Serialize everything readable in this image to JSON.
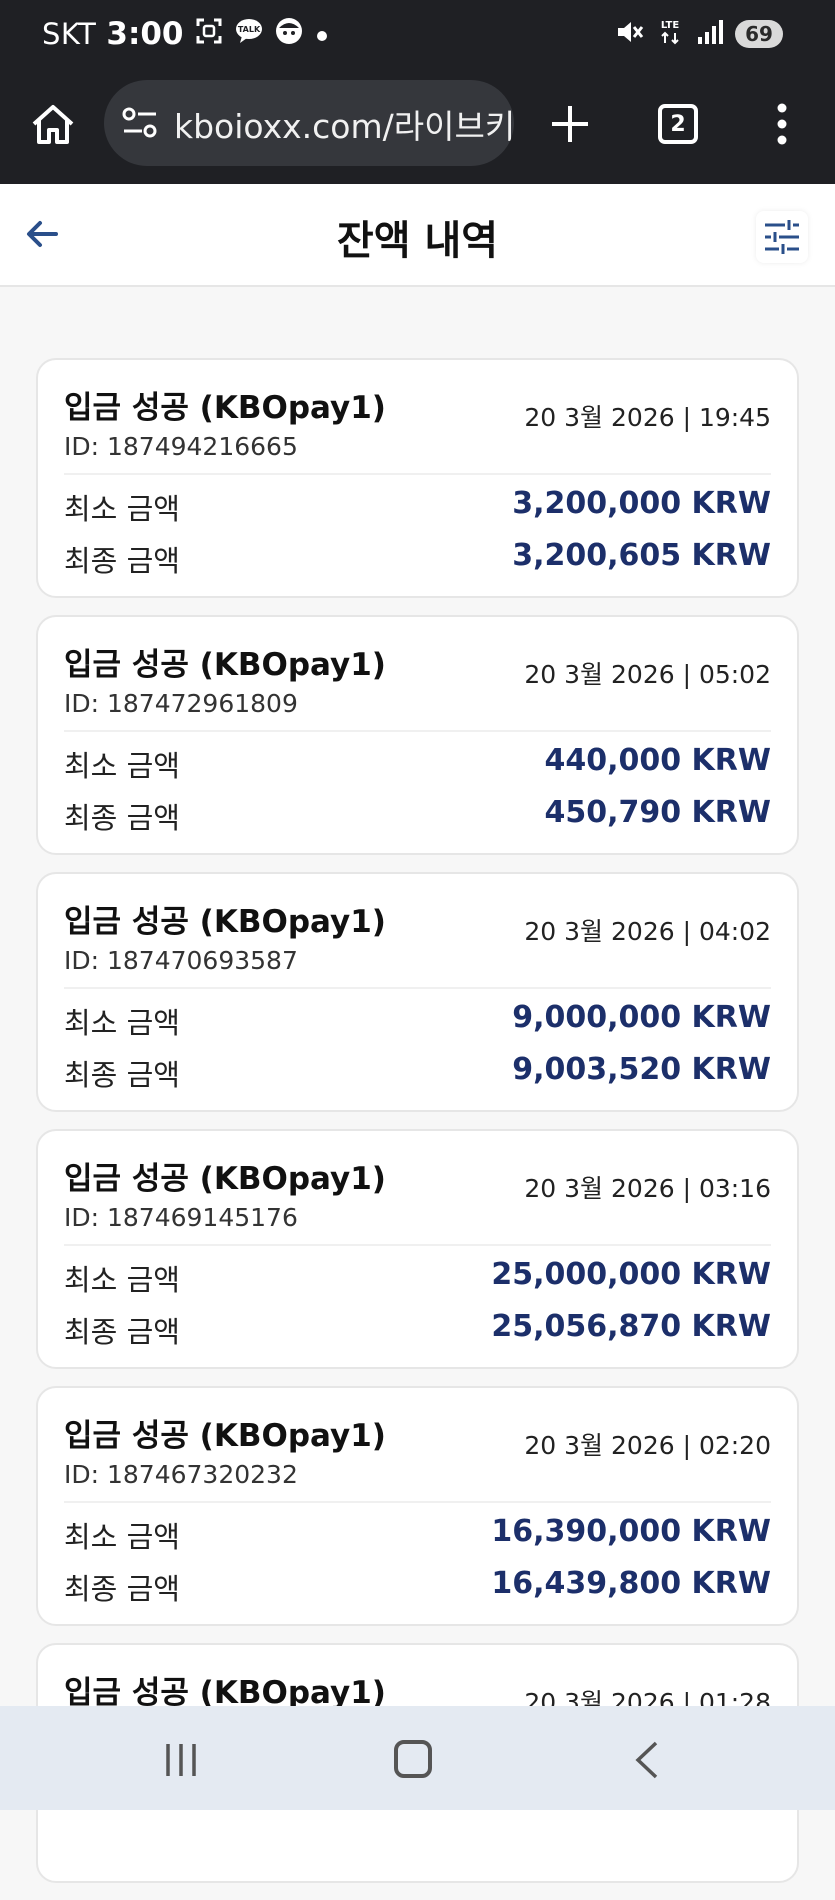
{
  "status_bar": {
    "carrier": "SKT",
    "time": "3:00",
    "network": "LTE",
    "battery": "69"
  },
  "browser": {
    "url": "kboioxx.com/라이브키",
    "tab_count": "2"
  },
  "header": {
    "title": "잔액 내역"
  },
  "labels": {
    "min_amount": "최소 금액",
    "final_amount": "최종 금액"
  },
  "transactions": [
    {
      "title": "입금 성공 (KBOpay1)",
      "date": "20 3월 2026 | 19:45",
      "id": "ID: 187494216665",
      "min": "3,200,000 KRW",
      "final": "3,200,605 KRW"
    },
    {
      "title": "입금 성공 (KBOpay1)",
      "date": "20 3월 2026 | 05:02",
      "id": "ID: 187472961809",
      "min": "440,000 KRW",
      "final": "450,790 KRW"
    },
    {
      "title": "입금 성공 (KBOpay1)",
      "date": "20 3월 2026 | 04:02",
      "id": "ID: 187470693587",
      "min": "9,000,000 KRW",
      "final": "9,003,520 KRW"
    },
    {
      "title": "입금 성공 (KBOpay1)",
      "date": "20 3월 2026 | 03:16",
      "id": "ID: 187469145176",
      "min": "25,000,000 KRW",
      "final": "25,056,870 KRW"
    },
    {
      "title": "입금 성공 (KBOpay1)",
      "date": "20 3월 2026 | 02:20",
      "id": "ID: 187467320232",
      "min": "16,390,000 KRW",
      "final": "16,439,800 KRW"
    },
    {
      "title": "입금 성공 (KBOpay1)",
      "date": "20 3월 2026 | 01:28",
      "id": "",
      "min": "",
      "final": ""
    }
  ]
}
